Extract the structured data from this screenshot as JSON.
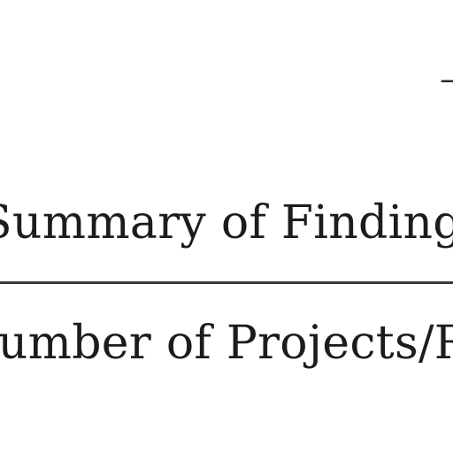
{
  "document": {
    "corner_mark": "—",
    "table_title": "Summary of Findings",
    "column_header": "Number of Projects/Reports"
  }
}
